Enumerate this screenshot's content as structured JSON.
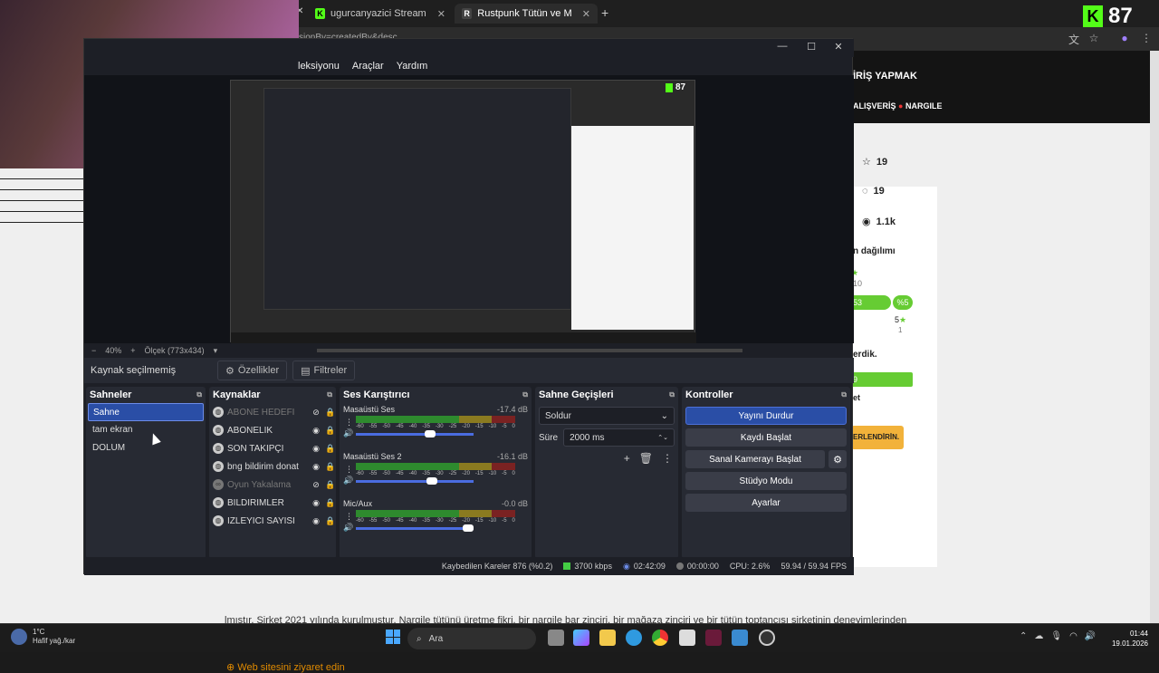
{
  "browser": {
    "tabs": [
      {
        "label": "ugurcanyazici Stream - Watch L",
        "active": false
      },
      {
        "label": "Rustpunk Tütün ve Meyve Aron",
        "active": true
      }
    ],
    "url_fragment": "sionBy=createdBy&desc"
  },
  "kick": {
    "viewers": "87"
  },
  "website": {
    "login": "İRİŞ YAPMAK",
    "nav_shopping": "ALIŞVERİŞ",
    "nav_hookah": "NARGILE",
    "stats": {
      "stars": "19",
      "comments": "19",
      "views": "1.1k"
    },
    "distribution_label": "n dağılımı",
    "rating_small": "10",
    "pct_left": "53",
    "pct_right": "%5",
    "rating_five": "5",
    "rating_one": "1",
    "verdik": "erdik.",
    "bar_num": "9",
    "et": "et",
    "cta": "ERLENDİRİN.",
    "about": "lmıştır. Şirket 2021 yılında kurulmuştur. Nargile tütünü üretme fikri, bir nargile bar zinciri, bir mağaza zinciri ve bir tütün toptancısı şirketinin deneyimlerinden ilham alınarak ortaya çıkmıştır.",
    "link": "Web sitesini ziyaret edin"
  },
  "obs": {
    "menu": [
      "leksiyonu",
      "Araçlar",
      "Yardım"
    ],
    "preview_kick": "87",
    "zoom": "40%",
    "scale": "Ölçek (773x434)",
    "source_bar": {
      "label": "Kaynak seçilmemiş",
      "properties": "Özellikler",
      "filters": "Filtreler"
    },
    "scenes": {
      "title": "Sahneler",
      "items": [
        "Sahne",
        "tam ekran",
        "DOLUM"
      ],
      "selected": 0
    },
    "sources": {
      "title": "Kaynaklar",
      "items": [
        {
          "name": "ABONE HEDEFİ",
          "hidden": true
        },
        {
          "name": "ABONELİK",
          "hidden": false
        },
        {
          "name": "SON TAKİPÇİ",
          "hidden": false
        },
        {
          "name": "bng bildirim donat",
          "hidden": false
        },
        {
          "name": "Oyun Yakalama",
          "hidden": true
        },
        {
          "name": "BİLDİRİMLER",
          "hidden": false
        },
        {
          "name": "İZLEYİCİ SAYISI",
          "hidden": false
        }
      ]
    },
    "mixer": {
      "title": "Ses Karıştırıcı",
      "channels": [
        {
          "name": "Masaüstü Ses",
          "db": "-17.4 dB",
          "level": 0.64
        },
        {
          "name": "Masaüstü Ses 2",
          "db": "-16.1 dB",
          "level": 0.66
        },
        {
          "name": "Mic/Aux",
          "db": "-0.0 dB",
          "level": 1.0
        }
      ],
      "scale": [
        "-60",
        "-55",
        "-50",
        "-45",
        "-40",
        "-35",
        "-30",
        "-25",
        "-20",
        "-15",
        "-10",
        "-5",
        "0"
      ]
    },
    "transitions": {
      "title": "Sahne Geçişleri",
      "type": "Soldur",
      "duration_label": "Süre",
      "duration": "2000 ms"
    },
    "controls": {
      "title": "Kontroller",
      "stop_stream": "Yayını Durdur",
      "start_recording": "Kaydı Başlat",
      "virtual_cam": "Sanal Kamerayı Başlat",
      "studio_mode": "Stüdyo Modu",
      "settings": "Ayarlar"
    },
    "status": {
      "dropped": "Kaybedilen Kareler 876 (%0.2)",
      "bitrate": "3700 kbps",
      "stream_time": "02:42:09",
      "rec_time": "00:00:00",
      "cpu": "CPU: 2.6%",
      "fps": "59.94 / 59.94 FPS"
    }
  },
  "taskbar": {
    "weather_temp": "1°C",
    "weather_desc": "Hafif yağ./kar",
    "search": "Ara",
    "time": "01:44",
    "date": "19.01.2026"
  }
}
